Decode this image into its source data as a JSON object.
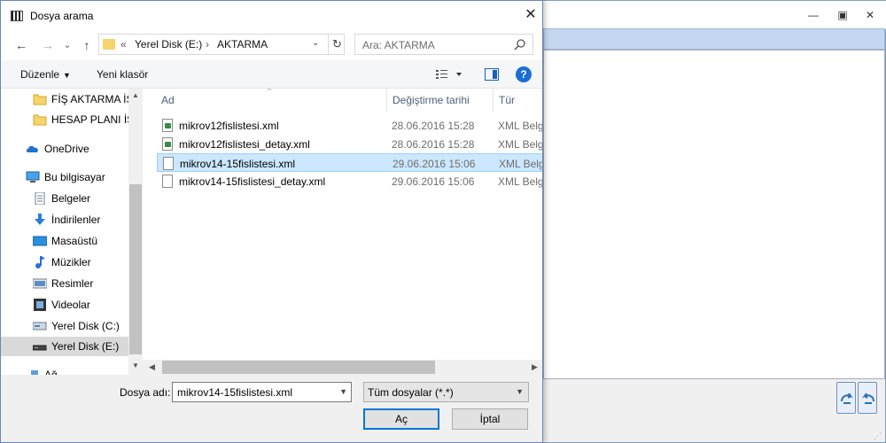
{
  "dialog": {
    "title": "Dosya arama",
    "close_symbol": "✕"
  },
  "nav": {
    "back_symbol": "←",
    "forward_symbol": "→",
    "dropdown_symbol": "⌄",
    "up_symbol": "↑",
    "address": {
      "prefix": "«",
      "segments": [
        "Yerel Disk (E:)",
        "AKTARMA"
      ],
      "separator": "›",
      "refresh_symbol": "↻"
    },
    "search_placeholder": "Ara: AKTARMA"
  },
  "toolbar": {
    "organize_label": "Düzenle",
    "new_folder_label": "Yeni klasör",
    "help_symbol": "?"
  },
  "sidebar": {
    "items": [
      {
        "label": "FİŞ AKTARMA İŞ",
        "icon": "folder-icon"
      },
      {
        "label": "HESAP PLANI İŞİ",
        "icon": "folder-icon"
      },
      {
        "label": "OneDrive",
        "icon": "cloud-icon"
      },
      {
        "label": "Bu bilgisayar",
        "icon": "computer-icon"
      },
      {
        "label": "Belgeler",
        "icon": "documents-icon"
      },
      {
        "label": "İndirilenler",
        "icon": "downloads-icon"
      },
      {
        "label": "Masaüstü",
        "icon": "desktop-icon"
      },
      {
        "label": "Müzikler",
        "icon": "music-icon"
      },
      {
        "label": "Resimler",
        "icon": "pictures-icon"
      },
      {
        "label": "Videolar",
        "icon": "videos-icon"
      },
      {
        "label": "Yerel Disk (C:)",
        "icon": "drive-icon"
      },
      {
        "label": "Yerel Disk (E:)",
        "icon": "drive-icon",
        "selected": true
      },
      {
        "label": "Ağ",
        "icon": "network-icon"
      }
    ]
  },
  "file_list": {
    "columns": [
      "Ad",
      "Değiştirme tarihi",
      "Tür"
    ],
    "sort_symbol": "^",
    "rows": [
      {
        "name": "mikrov12fislistesi.xml",
        "date": "28.06.2016 15:28",
        "type": "XML Belge",
        "icon": "xml-file-icon"
      },
      {
        "name": "mikrov12fislistesi_detay.xml",
        "date": "28.06.2016 15:28",
        "type": "XML Belge",
        "icon": "xml-file-icon"
      },
      {
        "name": "mikrov14-15fislistesi.xml",
        "date": "29.06.2016 15:06",
        "type": "XML Belge",
        "icon": "file-icon",
        "selected": true
      },
      {
        "name": "mikrov14-15fislistesi_detay.xml",
        "date": "29.06.2016 15:06",
        "type": "XML Belge",
        "icon": "file-icon"
      }
    ]
  },
  "bottom": {
    "filename_label": "Dosya adı:",
    "filename_value": "mikrov14-15fislistesi.xml",
    "filetype_value": "Tüm dosyalar (*.*)",
    "open_label": "Aç",
    "cancel_label": "İptal"
  },
  "background_window": {
    "minimize_symbol": "—",
    "restore_symbol": "▣",
    "close_symbol": "✕"
  },
  "colors": {
    "selection": "#cce8ff",
    "accent": "#0078d7",
    "folder": "#f6d36b"
  }
}
